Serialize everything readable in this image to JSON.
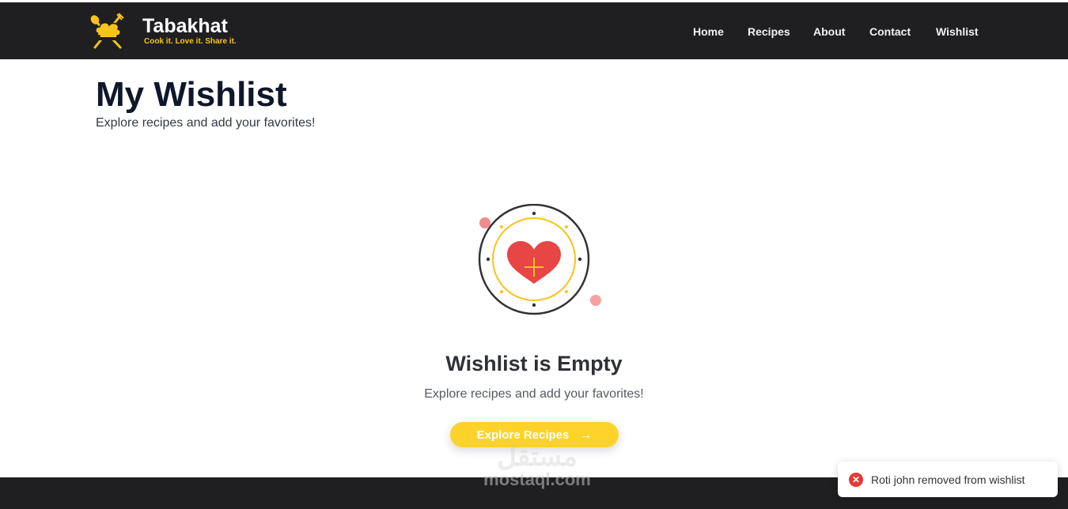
{
  "header": {
    "brand": "Tabakhat",
    "tagline": "Cook it. Love it. Share it.",
    "nav": [
      "Home",
      "Recipes",
      "About",
      "Contact",
      "Wishlist"
    ]
  },
  "main": {
    "title": "My Wishlist",
    "subtitle": "Explore recipes and add your favorites!",
    "empty_title": "Wishlist is Empty",
    "empty_subtitle": "Explore recipes and add your favorites!",
    "explore_button": "Explore Recipes",
    "explore_icon": "arrow-right-icon"
  },
  "watermark": {
    "arabic": "مستقل",
    "latin": "mostaql.com"
  },
  "toast": {
    "message": "Roti john removed from wishlist",
    "icon": "error-x-icon"
  },
  "colors": {
    "header_bg": "#1f1f21",
    "accent_yellow": "#fdd22b",
    "heart_red": "#e84545",
    "toast_error": "#e53935"
  }
}
